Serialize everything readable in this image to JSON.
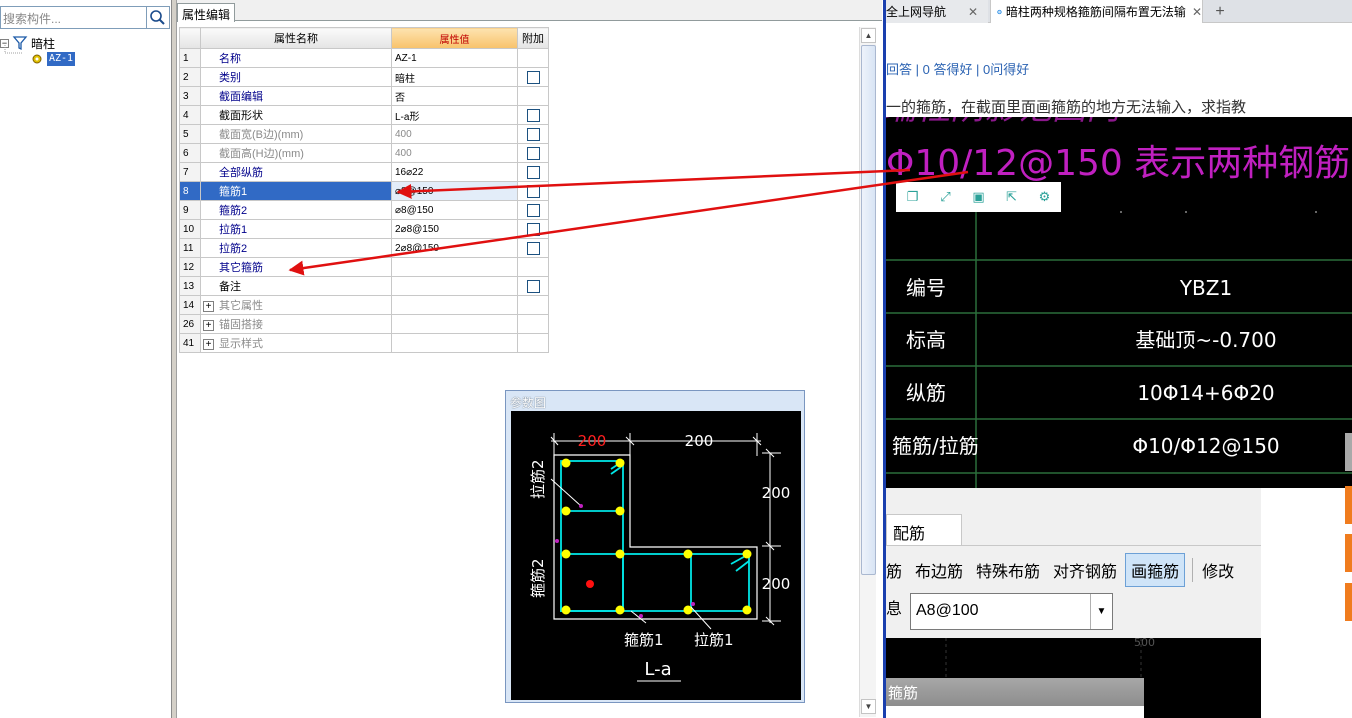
{
  "left_panel": {
    "search_placeholder": "搜索构件...",
    "tree_root_label": "暗柱",
    "tree_child_label": "AZ-1"
  },
  "property_editor": {
    "tab_label": "属性编辑",
    "headers": {
      "name": "属性名称",
      "value": "属性值",
      "extra": "附加"
    },
    "rows": [
      {
        "num": "1",
        "name": "名称",
        "value": "AZ-1",
        "style": "blue",
        "checkbox": false
      },
      {
        "num": "2",
        "name": "类别",
        "value": "暗柱",
        "style": "blue",
        "checkbox": true
      },
      {
        "num": "3",
        "name": "截面编辑",
        "value": "否",
        "style": "blue",
        "checkbox": false
      },
      {
        "num": "4",
        "name": "截面形状",
        "value": "L-a形",
        "style": "black",
        "checkbox": true
      },
      {
        "num": "5",
        "name": "截面宽(B边)(mm)",
        "value": "400",
        "style": "gray",
        "checkbox": true
      },
      {
        "num": "6",
        "name": "截面高(H边)(mm)",
        "value": "400",
        "style": "gray",
        "checkbox": true
      },
      {
        "num": "7",
        "name": "全部纵筋",
        "value": "16⌀22",
        "style": "blue",
        "checkbox": true
      },
      {
        "num": "8",
        "name": "箍筋1",
        "value": "⌀8@150",
        "style": "selected",
        "checkbox": true
      },
      {
        "num": "9",
        "name": "箍筋2",
        "value": "⌀8@150",
        "style": "blue",
        "checkbox": true
      },
      {
        "num": "10",
        "name": "拉筋1",
        "value": "2⌀8@150",
        "style": "blue",
        "checkbox": true
      },
      {
        "num": "11",
        "name": "拉筋2",
        "value": "2⌀8@150",
        "style": "blue",
        "checkbox": true
      },
      {
        "num": "12",
        "name": "其它箍筋",
        "value": "",
        "style": "blue",
        "checkbox": false
      },
      {
        "num": "13",
        "name": "备注",
        "value": "",
        "style": "black",
        "checkbox": true
      },
      {
        "num": "14",
        "name": "其它属性",
        "value": "",
        "style": "group",
        "checkbox": false
      },
      {
        "num": "26",
        "name": "锚固搭接",
        "value": "",
        "style": "group",
        "checkbox": false
      },
      {
        "num": "41",
        "name": "显示样式",
        "value": "",
        "style": "group",
        "checkbox": false
      }
    ]
  },
  "param_diagram": {
    "title": "参数图",
    "dim_top_left": "200",
    "dim_top_right": "200",
    "dim_right_top": "200",
    "dim_right_bottom": "200",
    "label_tie2": "拉筋2",
    "label_stirrup2": "箍筋2",
    "label_stirrup1": "箍筋1",
    "label_tie1": "拉筋1",
    "shape_name": "L-a"
  },
  "browser": {
    "tab1_title": "全上网导航",
    "tab2_title": "暗柱两种规格箍筋间隔布置无法输",
    "new_tab_symbol": "+",
    "answer_stats": "回答 | 0 答得好 | 0问得好",
    "question_text": "一的箍筋，在截面里面画箍筋的地方无法输入，求指教",
    "cad_header_text": "Φ10/12@150 表示两种钢筋间隔布置",
    "cad_table": [
      {
        "label": "编号",
        "value": "YBZ1"
      },
      {
        "label": "标高",
        "value": "基础顶~-0.700"
      },
      {
        "label": "纵筋",
        "value": "10Φ14+6Φ20"
      },
      {
        "label": "箍筋/拉筋",
        "value": "Φ10/Φ12@150"
      }
    ],
    "app2_tab": "配筋",
    "app2_buttons": [
      "布边筋",
      "特殊布筋",
      "对齐钢筋",
      "画箍筋",
      "修改"
    ],
    "app2_button_lead": "筋",
    "app2_active_button": "画箍筋",
    "app2_info_label": "息",
    "app2_select_value": "A8@100",
    "app2_canvas_tick": "500",
    "app2_panel_title": "箍筋"
  },
  "colors": {
    "selection": "#316ac5",
    "value_header": "#f8c26b",
    "annotation_arrow": "#e01010",
    "cad_cyan": "#00e5e5",
    "cad_yellow": "#ffff00",
    "cad_magenta": "#c020c0",
    "browser_accent": "#1a3fae"
  }
}
